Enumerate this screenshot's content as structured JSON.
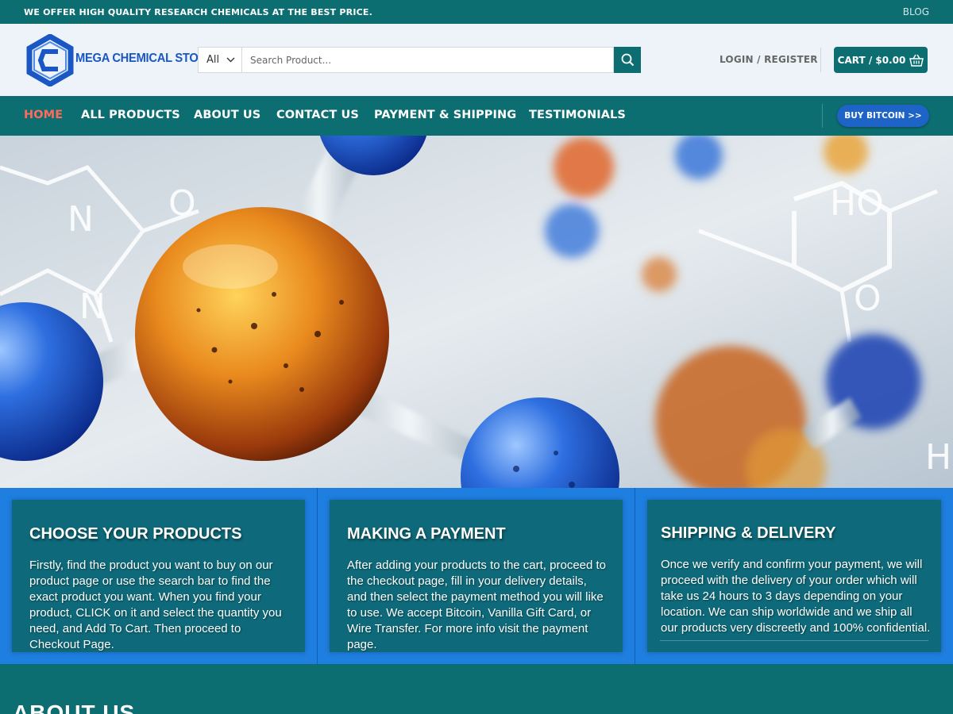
{
  "topbar": {
    "promo": "WE OFFER HIGH QUALITY RESEARCH CHEMICALS AT THE BEST PRICE.",
    "blog": "BLOG"
  },
  "header": {
    "logo_text": "MEGA CHEMICAL STORE",
    "search_category": "All",
    "search_placeholder": "Search Product...",
    "login_label": "LOGIN / REGISTER",
    "cart_label": "CART / $0.00"
  },
  "nav": {
    "items": [
      {
        "label": "HOME",
        "active": true
      },
      {
        "label": "ALL PRODUCTS",
        "active": false
      },
      {
        "label": "ABOUT US",
        "active": false
      },
      {
        "label": "CONTACT US",
        "active": false
      },
      {
        "label": "PAYMENT & SHIPPING",
        "active": false
      },
      {
        "label": "TESTIMONIALS",
        "active": false
      }
    ],
    "bitcoin_button": "BUY BITCOIN >>"
  },
  "features": [
    {
      "title": "CHOOSE YOUR PRODUCTS",
      "text": "Firstly, find the product you want to buy on our product page or use the search bar to find the exact product you want. When you find your product, CLICK on it and select the quantity you need, and Add To Cart. Then proceed to Checkout Page."
    },
    {
      "title": "MAKING A PAYMENT",
      "text": "After adding your products to the cart, proceed to the checkout page, fill in your delivery details, and then select the payment method you will like to use. We accept Bitcoin, Vanilla Gift Card, or Wire Transfer. For more info visit the payment page."
    },
    {
      "title": "SHIPPING & DELIVERY",
      "text": "Once we verify and confirm your payment, we will proceed with the delivery of your order which will take us 24 hours to 3 days depending on your location. We can ship worldwide and we ship all our products very discreetly and 100% confidential."
    }
  ],
  "about": {
    "heading": "ABOUT US"
  },
  "colors": {
    "primary": "#0d6e72",
    "accent_active": "#ff6a5c",
    "features_bg": "#1e7fe0",
    "bitcoin_button": "#1e63c6"
  },
  "icons": [
    "logo-hexagon-icon",
    "chevron-down-icon",
    "search-icon",
    "basket-icon"
  ]
}
